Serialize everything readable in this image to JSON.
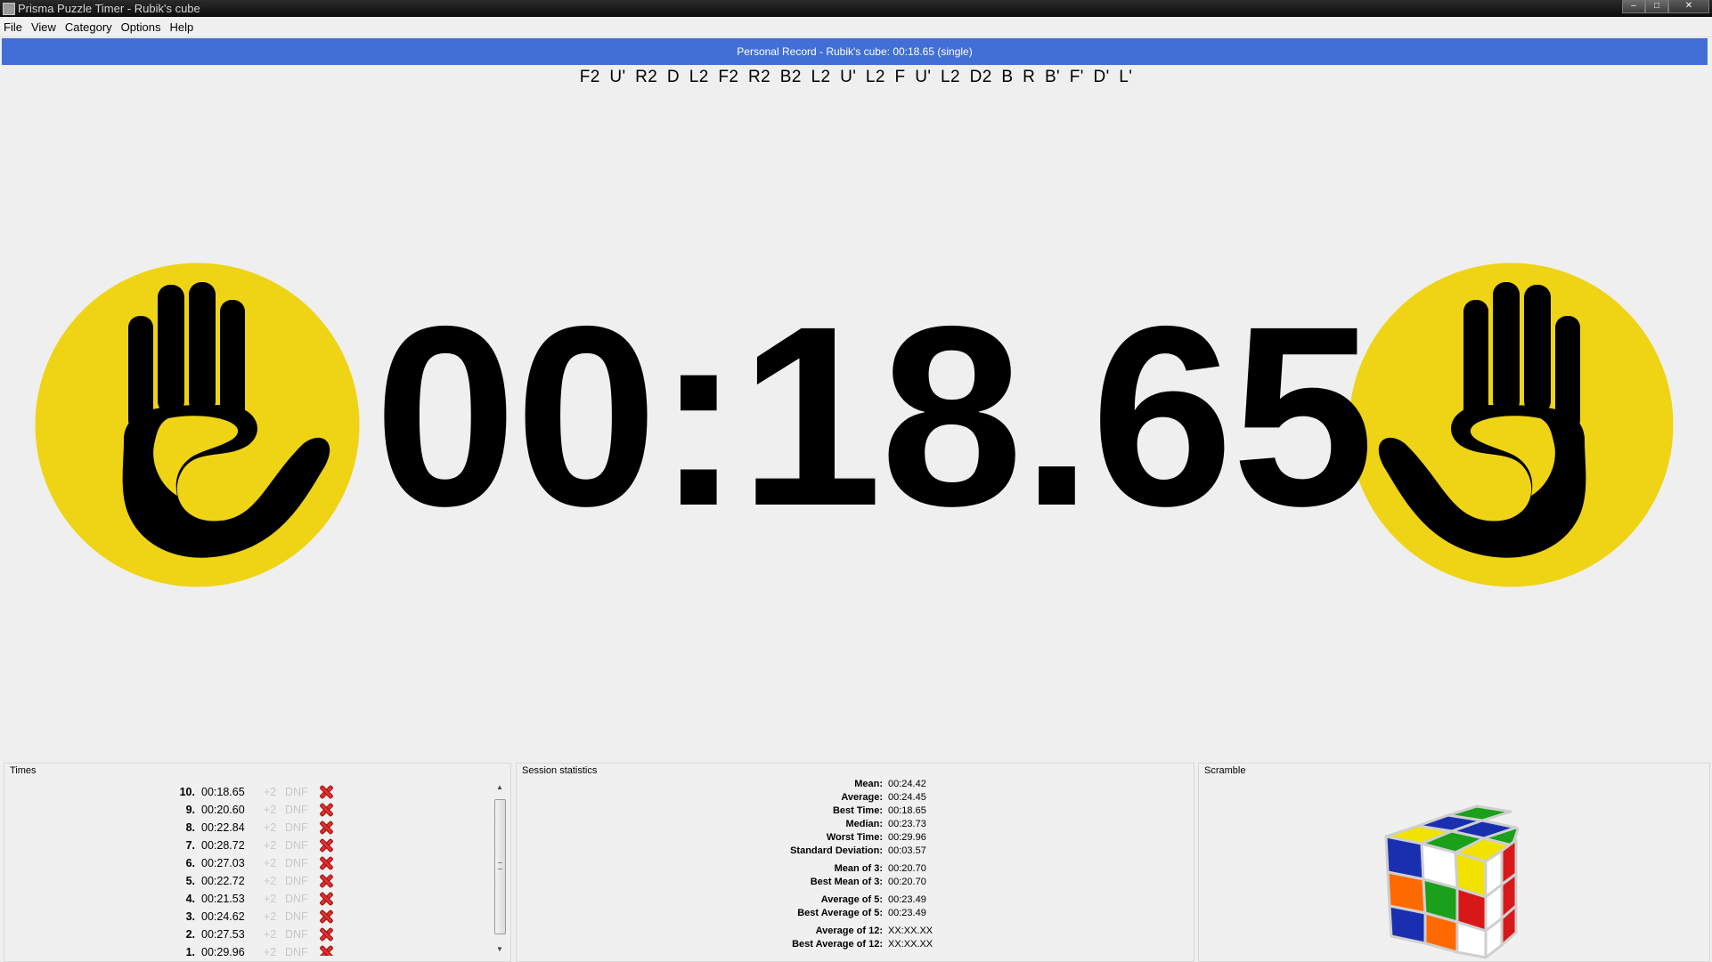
{
  "window": {
    "title": "Prisma Puzzle Timer - Rubik's cube",
    "minimize": "–",
    "maximize": "□",
    "close": "✕"
  },
  "menu": [
    "File",
    "View",
    "Category",
    "Options",
    "Help"
  ],
  "personal_record": "Personal Record - Rubik's cube: 00:18.65 (single)",
  "scramble": "F2 U' R2 D L2 F2 R2 B2 L2 U' L2 F U' L2 D2 B R B' F' D' L'",
  "timer": {
    "value": "00:18.65",
    "left_icon": "hand-stop-icon",
    "right_icon": "hand-stop-icon",
    "icon_color": "#eed414"
  },
  "times": {
    "title": "Times",
    "penalty_label": "+2",
    "dnf_label": "DNF",
    "rows": [
      {
        "idx": "10.",
        "time": "00:18.65"
      },
      {
        "idx": "9.",
        "time": "00:20.60"
      },
      {
        "idx": "8.",
        "time": "00:22.84"
      },
      {
        "idx": "7.",
        "time": "00:28.72"
      },
      {
        "idx": "6.",
        "time": "00:27.03"
      },
      {
        "idx": "5.",
        "time": "00:22.72"
      },
      {
        "idx": "4.",
        "time": "00:21.53"
      },
      {
        "idx": "3.",
        "time": "00:24.62"
      },
      {
        "idx": "2.",
        "time": "00:27.53"
      },
      {
        "idx": "1.",
        "time": "00:29.96"
      }
    ]
  },
  "stats": {
    "title": "Session statistics",
    "mean": {
      "label": "Mean:",
      "value": "00:24.42"
    },
    "average": {
      "label": "Average:",
      "value": "00:24.45"
    },
    "best_time": {
      "label": "Best Time:",
      "value": "00:18.65"
    },
    "median": {
      "label": "Median:",
      "value": "00:23.73"
    },
    "worst_time": {
      "label": "Worst Time:",
      "value": "00:29.96"
    },
    "std_dev": {
      "label": "Standard Deviation:",
      "value": "00:03.57"
    },
    "mean3": {
      "label": "Mean of 3:",
      "value": "00:20.70"
    },
    "best_mean3": {
      "label": "Best Mean of 3:",
      "value": "00:20.70"
    },
    "avg5": {
      "label": "Average of 5:",
      "value": "00:23.49"
    },
    "best_avg5": {
      "label": "Best Average of 5:",
      "value": "00:23.49"
    },
    "avg12": {
      "label": "Average of 12:",
      "value": "XX:XX.XX"
    },
    "best_avg12": {
      "label": "Best Average of 12:",
      "value": "XX:XX.XX"
    }
  },
  "scramble_panel": {
    "title": "Scramble",
    "cube_colors": {
      "white": "#ffffff",
      "yellow": "#f2e200",
      "green": "#1aa01a",
      "blue": "#1a2fb0",
      "red": "#d81818",
      "orange": "#ff6a00"
    }
  }
}
